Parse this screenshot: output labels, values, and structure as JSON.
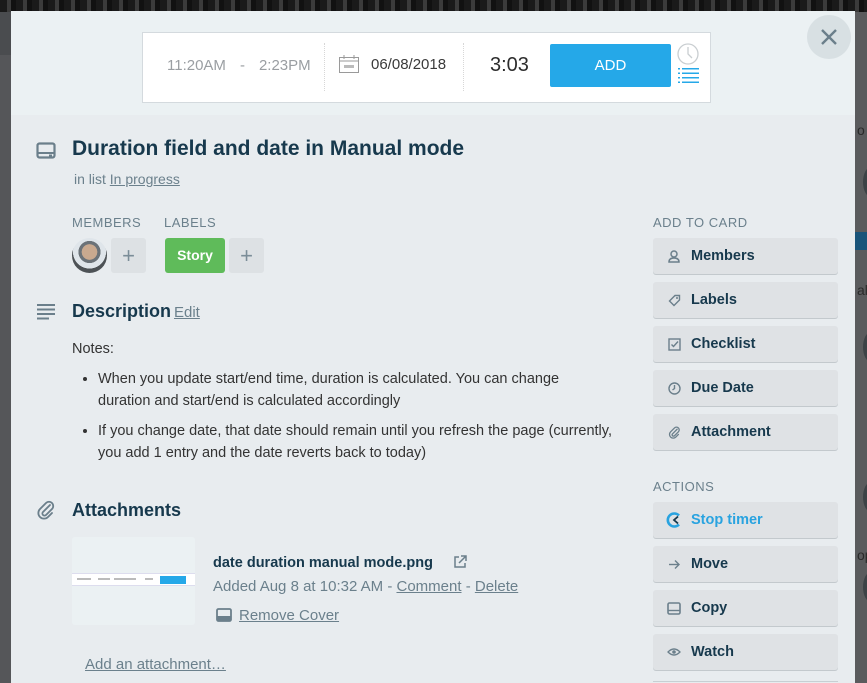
{
  "timer": {
    "start_time": "11:20AM",
    "separator": "-",
    "end_time": "2:23PM",
    "date": "06/08/2018",
    "duration": "3:03",
    "add_label": "ADD",
    "accent_color": "#25a8e8"
  },
  "card": {
    "title": "Duration field and date in Manual mode",
    "in_list_prefix": "in list",
    "list_name": "In progress"
  },
  "members": {
    "heading": "MEMBERS",
    "add_label": "+"
  },
  "labels": {
    "heading": "LABELS",
    "items": [
      {
        "name": "Story",
        "color": "#5fbb5a"
      }
    ],
    "add_label": "+"
  },
  "description": {
    "heading": "Description",
    "edit_label": "Edit",
    "notes_label": "Notes:",
    "bullets": [
      "When you update start/end time, duration is calculated. You can change duration and start/end is calculated accordingly",
      "If you change date, that date should remain until you refresh the page (currently, you add 1 entry and the date reverts back to today)"
    ]
  },
  "attachments": {
    "heading": "Attachments",
    "items": [
      {
        "filename": "date duration manual mode.png",
        "added": "Added Aug 8 at 10:32 AM",
        "sep": "-",
        "comment_label": "Comment",
        "delete_label": "Delete",
        "remove_cover_label": "Remove Cover"
      }
    ],
    "add_label": "Add an attachment…"
  },
  "sidebar": {
    "add_to_card_heading": "ADD TO CARD",
    "add_to_card": [
      {
        "label": "Members",
        "icon": "person-icon"
      },
      {
        "label": "Labels",
        "icon": "tag-icon"
      },
      {
        "label": "Checklist",
        "icon": "checkbox-icon"
      },
      {
        "label": "Due Date",
        "icon": "clock-icon"
      },
      {
        "label": "Attachment",
        "icon": "paperclip-icon"
      }
    ],
    "actions_heading": "ACTIONS",
    "actions": [
      {
        "label": "Stop timer",
        "icon": "timer-logo-icon",
        "color": "#29a3e0"
      },
      {
        "label": "Move",
        "icon": "arrow-right-icon"
      },
      {
        "label": "Copy",
        "icon": "card-icon"
      },
      {
        "label": "Watch",
        "icon": "eye-icon"
      }
    ]
  },
  "backdrop": {
    "fragments": [
      "o",
      "al",
      "op"
    ]
  }
}
